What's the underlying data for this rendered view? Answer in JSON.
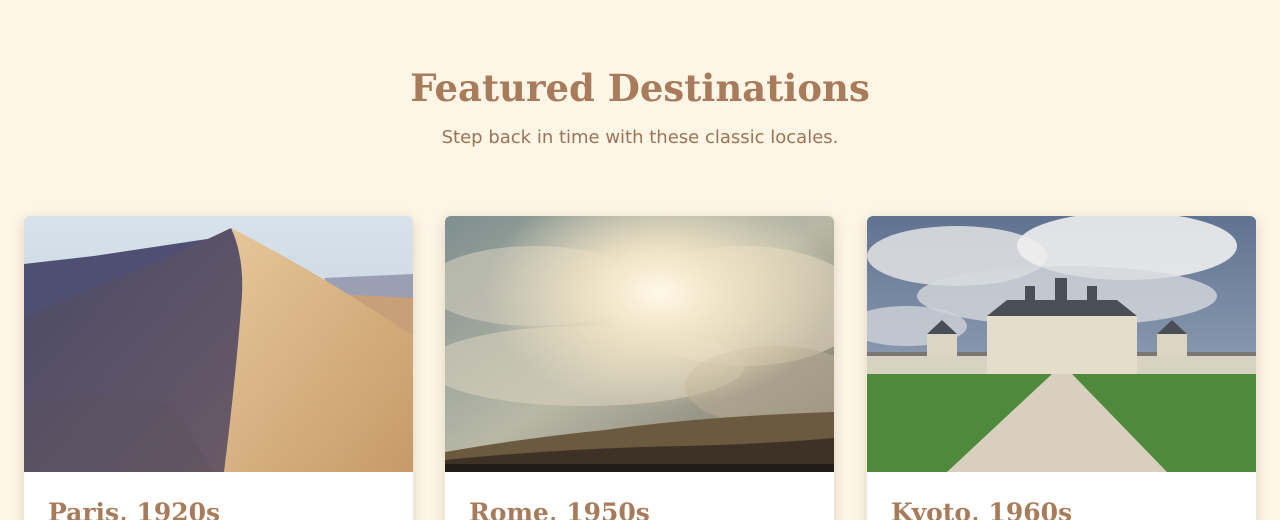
{
  "section": {
    "title": "Featured Destinations",
    "subtitle": "Step back in time with these classic locales."
  },
  "destinations": [
    {
      "title": "Paris, 1920s",
      "image": "desert-sand-dune-photo"
    },
    {
      "title": "Rome, 1950s",
      "image": "sunlit-clouds-over-hills-photo"
    },
    {
      "title": "Kyoto, 1960s",
      "image": "chateau-with-lawn-and-path-photo"
    }
  ],
  "colors": {
    "background": "#fdf5e6",
    "accent": "#a87c5b",
    "subtitle": "#9c7355",
    "card": "#ffffff"
  }
}
